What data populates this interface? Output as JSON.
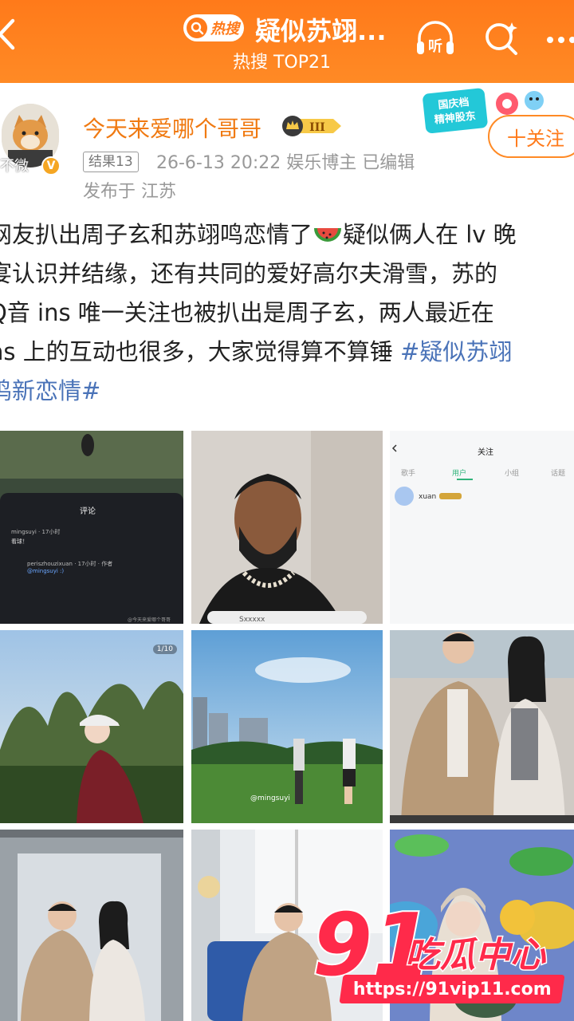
{
  "topbar": {
    "hot_label": "热搜",
    "title": "疑似苏翊...",
    "subtitle": "热搜 TOP21",
    "icons": [
      "back-icon",
      "listen-icon",
      "search-ai-icon",
      "more-icon"
    ],
    "colors": {
      "bar": "#ff7a1a",
      "text": "#ffffff"
    }
  },
  "post": {
    "username": "今天来爱哪个哥哥",
    "level": "III",
    "avatar_caption": "不微",
    "result_tag": "结果13",
    "meta": "26-6-13 20:22  娱乐博主  已编辑",
    "location": "发布于 江苏",
    "event_badge": "国庆档 精神股东",
    "follow_label": "十关注",
    "body_lines": [
      "网友扒出周子玄和苏翊鸣恋情了",
      "疑似俩人在 lv 晚",
      "宴认识并结缘，还有共同的爱好高尔夫滑雪，苏的",
      "Q音 ins 唯一关注也被扒出是周子玄，两人最近在",
      "ns 上的互动也很多，大家觉得算不算锤 ",
      "#疑似苏翊",
      "鸣新恋情#"
    ],
    "name_color": "#f07a12",
    "hashtag_color": "#4a73b8"
  },
  "grid": {
    "c1": {
      "sheet_title": "评论",
      "n1": "mingsuyi · 17小时",
      "m1": "看球！",
      "n2": "periszhouzixuan · 17小时 · 作者",
      "m2": "@mingsuyi :)",
      "wm": "@今天来爱哪个哥哥"
    },
    "c2": {
      "tag": "Sxxxxx"
    },
    "c3": {
      "title": "关注",
      "tabs": [
        "歌手",
        "用户",
        "小组",
        "话题"
      ],
      "xuan": "xuan"
    },
    "c4": {
      "page": "1/10"
    },
    "c5": {
      "tag": "@mingsuyi"
    }
  },
  "watermark": {
    "logo_number": "91",
    "logo_text": "吃瓜中心",
    "url": "https://91vip11.com",
    "color": "#ff2a4a"
  }
}
